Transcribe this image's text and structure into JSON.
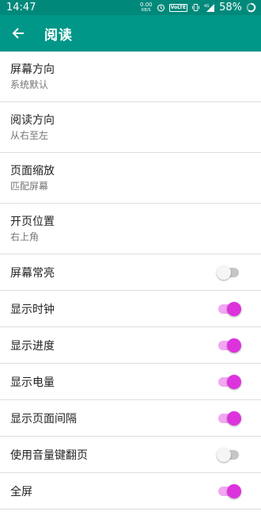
{
  "status_bar": {
    "time": "14:47",
    "net_speed": "0.00",
    "net_unit": "KB/S",
    "volte": "VoLTE",
    "network": "4G",
    "battery": "58%"
  },
  "app_bar": {
    "title": "阅读"
  },
  "settings": {
    "screen_orientation": {
      "title": "屏幕方向",
      "value": "系统默认"
    },
    "read_direction": {
      "title": "阅读方向",
      "value": "从右至左"
    },
    "page_scale": {
      "title": "页面缩放",
      "value": "匹配屏幕"
    },
    "start_position": {
      "title": "开页位置",
      "value": "右上角"
    },
    "keep_screen_on": {
      "title": "屏幕常亮",
      "enabled": false
    },
    "show_clock": {
      "title": "显示时钟",
      "enabled": true
    },
    "show_progress": {
      "title": "显示进度",
      "enabled": true
    },
    "show_battery": {
      "title": "显示电量",
      "enabled": true
    },
    "show_page_interval": {
      "title": "显示页面间隔",
      "enabled": true
    },
    "volume_key_turn": {
      "title": "使用音量键翻页",
      "enabled": false
    },
    "fullscreen": {
      "title": "全屏",
      "enabled": true
    }
  }
}
